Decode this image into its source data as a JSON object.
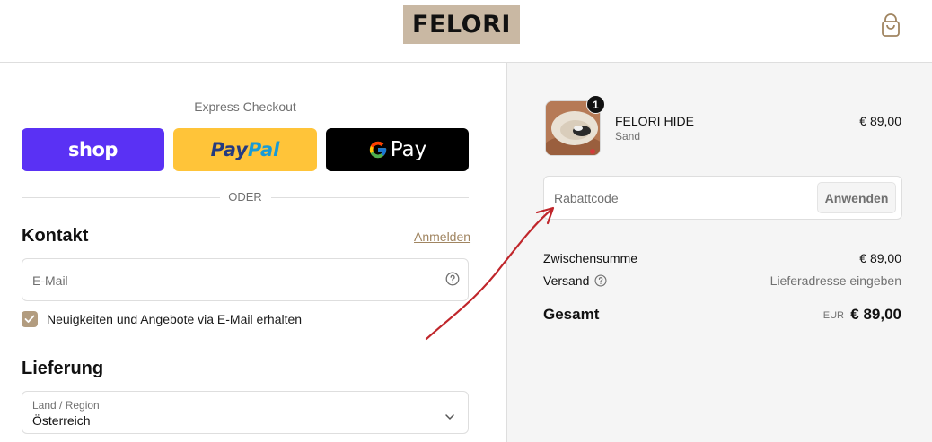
{
  "header": {
    "logo_text": "FELORI",
    "cart_icon": "shopping-bag-icon"
  },
  "express": {
    "title": "Express Checkout",
    "shop_label": "shop",
    "paypal_label_1": "Pay",
    "paypal_label_2": "Pal",
    "gpay_label": "Pay",
    "divider_text": "ODER"
  },
  "contact": {
    "heading": "Kontakt",
    "login_link": "Anmelden",
    "email_placeholder": "E-Mail",
    "newsletter_label": "Neuigkeiten und Angebote via E-Mail erhalten",
    "newsletter_checked": true
  },
  "delivery": {
    "heading": "Lieferung",
    "country_label": "Land / Region",
    "country_value": "Österreich"
  },
  "summary": {
    "product_name": "FELORI HIDE",
    "product_variant": "Sand",
    "product_price": "€ 89,00",
    "quantity": "1",
    "discount_placeholder": "Rabattcode",
    "apply_label": "Anwenden",
    "subtotal_label": "Zwischensumme",
    "subtotal_value": "€ 89,00",
    "shipping_label": "Versand",
    "shipping_value": "Lieferadresse eingeben",
    "total_label": "Gesamt",
    "total_currency": "EUR",
    "total_value": "€ 89,00"
  },
  "colors": {
    "accent": "#a08561",
    "logo_bg": "#c9b8a3",
    "shop_pay": "#5a31f4",
    "paypal": "#ffc439",
    "annotation_arrow": "#c0262b"
  }
}
